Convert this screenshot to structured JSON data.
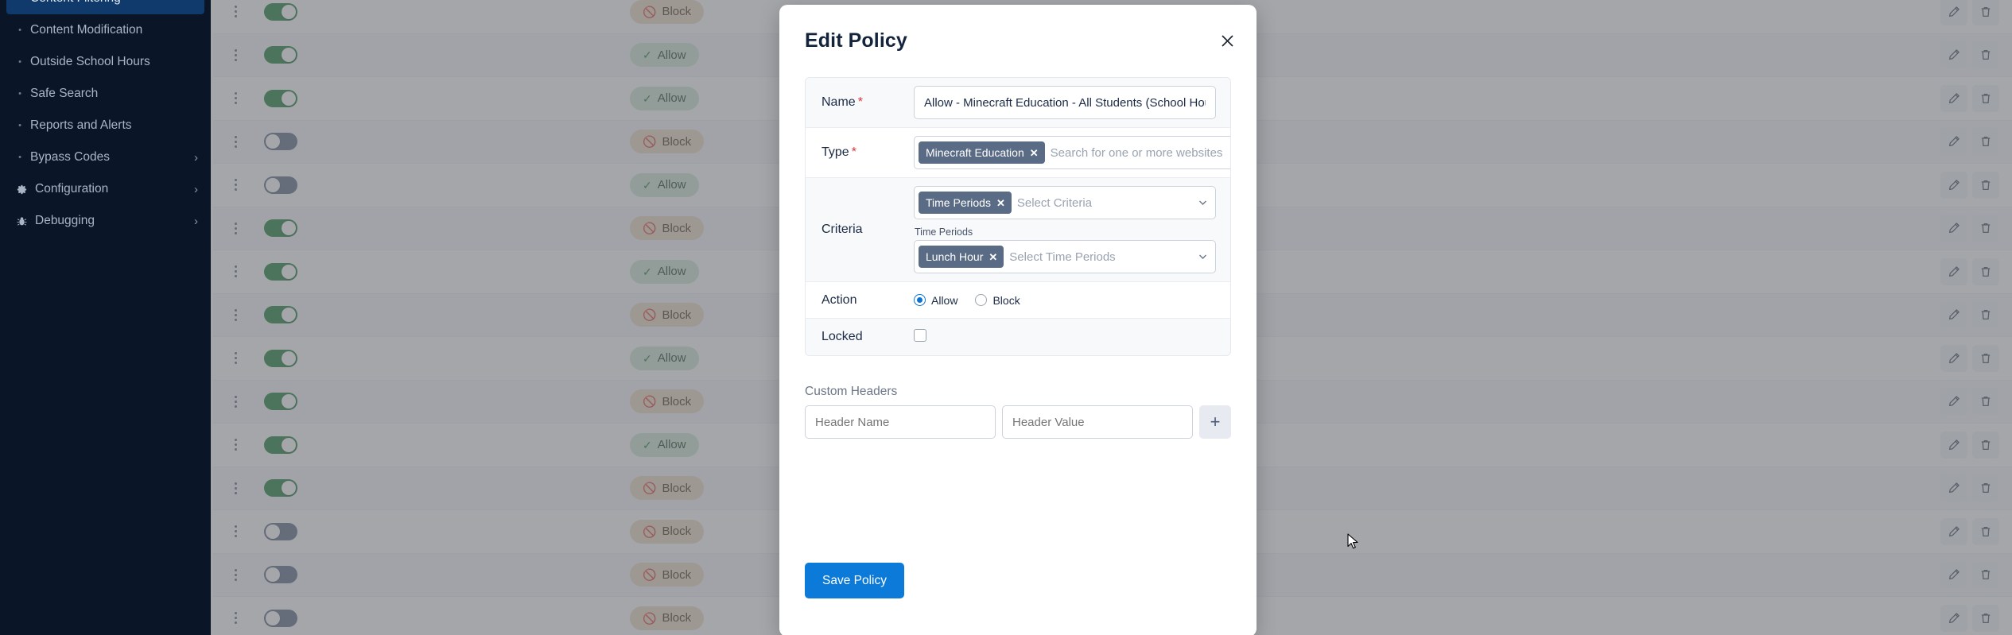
{
  "sidebar": {
    "items": [
      {
        "label": "Content Filtering",
        "icon": "bullet-dot-icon",
        "active": true,
        "chevron": false
      },
      {
        "label": "Content Modification",
        "icon": "bullet-dot-icon",
        "active": false,
        "chevron": false
      },
      {
        "label": "Outside School Hours",
        "icon": "bullet-dot-icon",
        "active": false,
        "chevron": false
      },
      {
        "label": "Safe Search",
        "icon": "bullet-dot-icon",
        "active": false,
        "chevron": false
      },
      {
        "label": "Reports and Alerts",
        "icon": "bullet-dot-icon",
        "active": false,
        "chevron": false
      },
      {
        "label": "Bypass Codes",
        "icon": "bullet-dot-icon",
        "active": false,
        "chevron": true
      },
      {
        "label": "Configuration",
        "icon": "gear-icon",
        "active": false,
        "chevron": true
      },
      {
        "label": "Debugging",
        "icon": "bug-icon",
        "active": false,
        "chevron": true
      }
    ]
  },
  "background_table": {
    "rows": [
      {
        "enabled": true,
        "action": "Block"
      },
      {
        "enabled": true,
        "action": "Allow"
      },
      {
        "enabled": true,
        "action": "Allow"
      },
      {
        "enabled": false,
        "action": "Block"
      },
      {
        "enabled": false,
        "action": "Allow"
      },
      {
        "enabled": true,
        "action": "Block"
      },
      {
        "enabled": true,
        "action": "Allow"
      },
      {
        "enabled": true,
        "action": "Block"
      },
      {
        "enabled": true,
        "action": "Allow"
      },
      {
        "enabled": true,
        "action": "Block"
      },
      {
        "enabled": true,
        "action": "Allow"
      },
      {
        "enabled": true,
        "action": "Block"
      },
      {
        "enabled": false,
        "action": "Block"
      },
      {
        "enabled": false,
        "action": "Block"
      },
      {
        "enabled": false,
        "action": "Block"
      }
    ],
    "row_icons": {
      "kebab": "kebab-menu-icon",
      "edit": "pencil-edit-icon",
      "delete": "trash-delete-icon",
      "allow": "check-icon",
      "block": "no-entry-icon"
    }
  },
  "modal": {
    "title": "Edit Policy",
    "close_icon": "close-x-icon",
    "fields": {
      "name": {
        "label": "Name",
        "required": true,
        "value": "Allow - Minecraft Education - All Students (School Hours)",
        "placeholder": ""
      },
      "type": {
        "label": "Type",
        "required": true,
        "chips": [
          "Minecraft Education"
        ],
        "placeholder": "Search for one or more websites",
        "caret_icon": "chevron-down-icon"
      },
      "criteria": {
        "label": "Criteria",
        "required": false,
        "chips": [
          "Time Periods"
        ],
        "placeholder": "Select Criteria",
        "caret_icon": "chevron-down-icon",
        "sub": {
          "label": "Time Periods",
          "chips": [
            "Lunch Hour"
          ],
          "placeholder": "Select Time Periods",
          "caret_icon": "chevron-down-icon"
        }
      },
      "action": {
        "label": "Action",
        "options": [
          {
            "label": "Allow",
            "selected": true
          },
          {
            "label": "Block",
            "selected": false
          }
        ]
      },
      "locked": {
        "label": "Locked",
        "checked": false
      }
    },
    "custom_headers": {
      "title": "Custom Headers",
      "name_placeholder": "Header Name",
      "name_value": "",
      "value_placeholder": "Header Value",
      "value_value": "",
      "add_label": "+",
      "add_icon": "plus-icon"
    },
    "save_label": "Save Policy"
  },
  "colors": {
    "sidebar_bg": "#0a1628",
    "sidebar_active": "#0f3a6b",
    "primary": "#0b7ad8",
    "chip": "#5a6b85",
    "allow_badge": "#cfe7d2",
    "block_badge": "#f0d9bf",
    "toggle_on": "#1a7a32",
    "toggle_off": "#5b6b82",
    "required_star": "#e0333f"
  }
}
